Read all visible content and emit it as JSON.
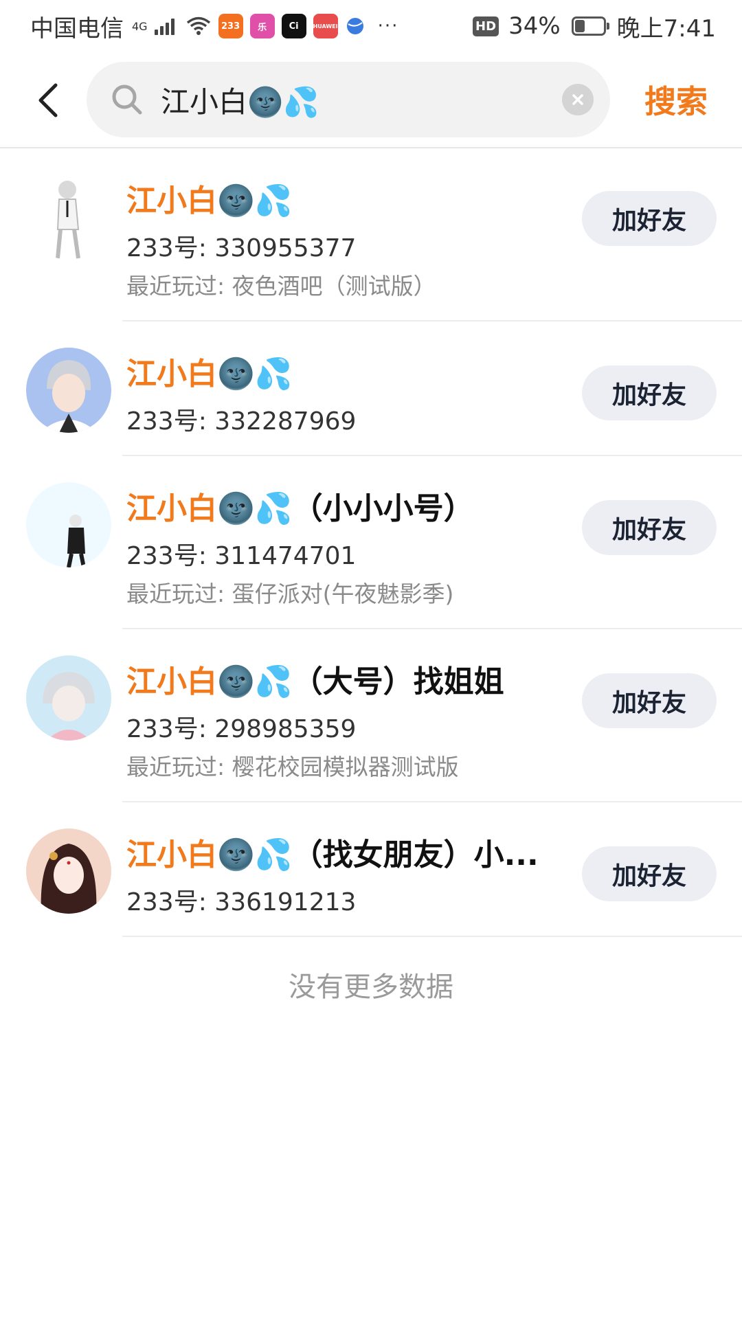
{
  "status_bar": {
    "carrier": "中国电信",
    "network": "4G",
    "apps": [
      "233",
      "乐",
      "Ci",
      "HUAWEI"
    ],
    "more": "···",
    "hd": "HD",
    "battery": "34%",
    "battery_level": 0.34,
    "time": "晚上7:41"
  },
  "search": {
    "query": "江小白🌚💦",
    "button_label": "搜索"
  },
  "results": [
    {
      "name_highlight": "江小白🌚💦",
      "name_rest": "",
      "id": "233号: 330955377",
      "recent": "最近玩过: 夜色酒吧（测试版）",
      "button": "加好友",
      "avatar_colors": [
        "#ffffff",
        "#e8e8e8"
      ]
    },
    {
      "name_highlight": "江小白🌚💦",
      "name_rest": "",
      "id": "233号: 332287969",
      "recent": "",
      "button": "加好友",
      "avatar_colors": [
        "#a9c2f0",
        "#6b86c9"
      ]
    },
    {
      "name_highlight": "江小白🌚💦",
      "name_rest": "（小小小号）",
      "id": "233号: 311474701",
      "recent": "最近玩过: 蛋仔派对(午夜魅影季)",
      "button": "加好友",
      "avatar_colors": [
        "#eefaff",
        "#cfeefb"
      ]
    },
    {
      "name_highlight": "江小白🌚💦",
      "name_rest": "（大号）找姐姐",
      "id": "233号: 298985359",
      "recent": "最近玩过: 樱花校园模拟器测试版",
      "button": "加好友",
      "avatar_colors": [
        "#cfe9f7",
        "#8fbfd8"
      ]
    },
    {
      "name_highlight": "江小白🌚💦",
      "name_rest": "（找女朋友）小...",
      "id": "233号: 336191213",
      "recent": "",
      "button": "加好友",
      "avatar_colors": [
        "#f3d6c8",
        "#7a3b35"
      ]
    }
  ],
  "footer": {
    "no_more": "没有更多数据"
  },
  "colors": {
    "accent": "#f07a1c",
    "button_bg": "#eceef4",
    "divider": "#ededed"
  }
}
